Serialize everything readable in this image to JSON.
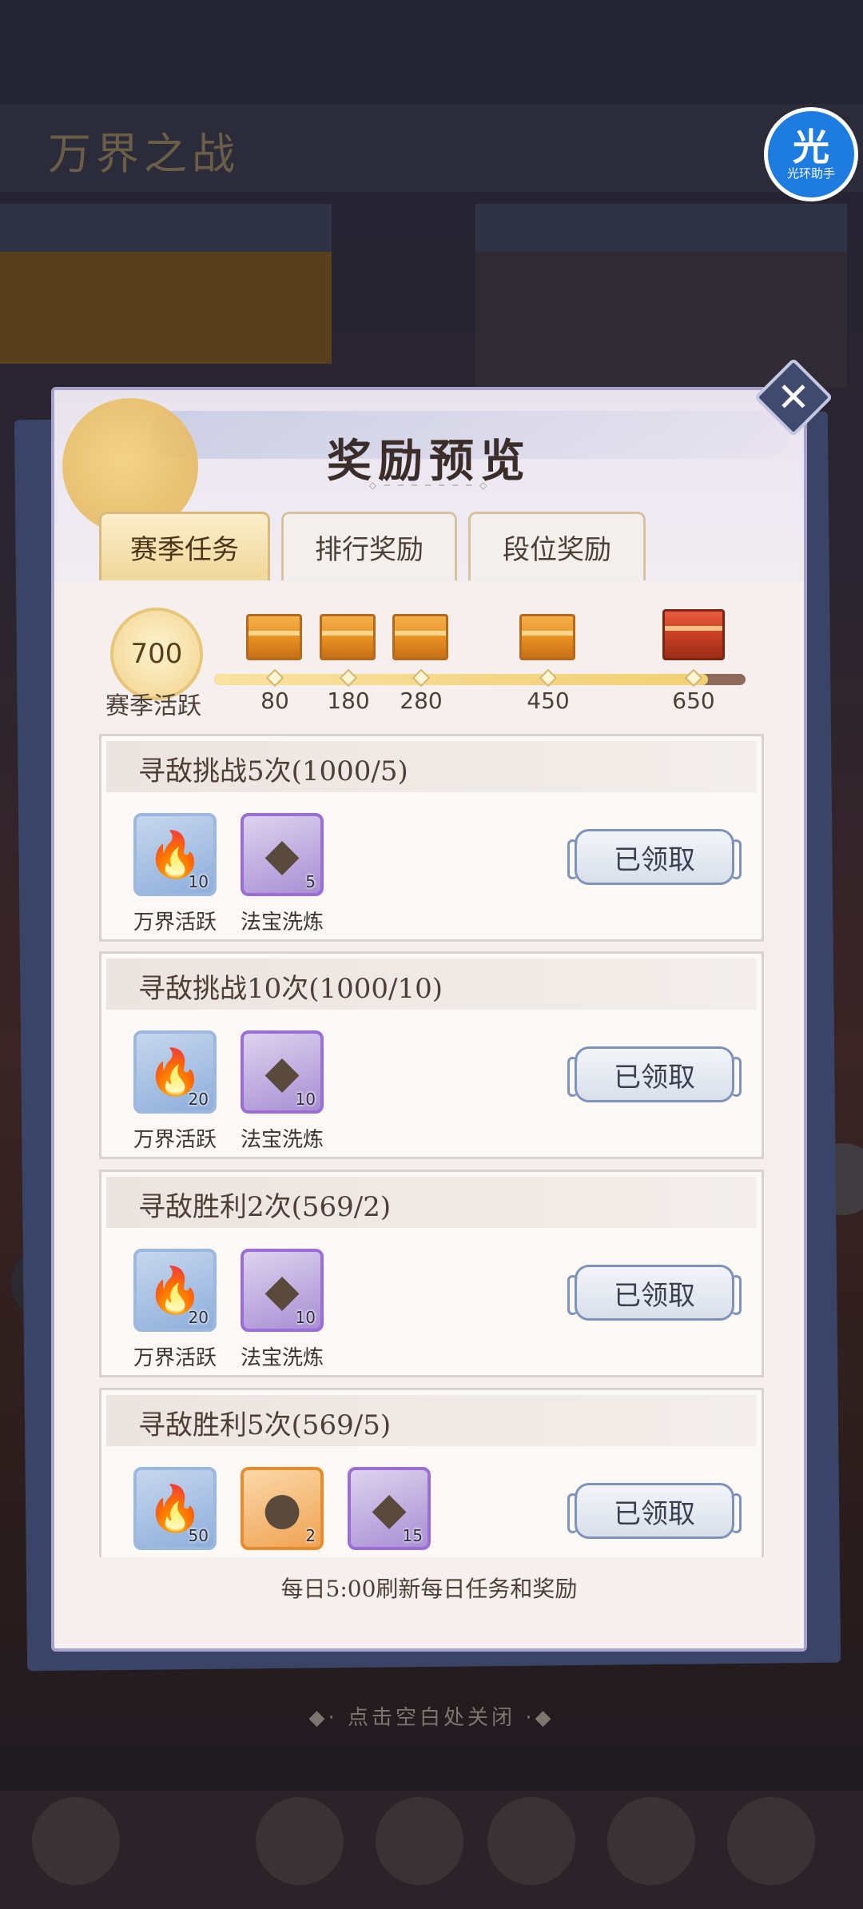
{
  "background": {
    "game_title": "万界之战",
    "close_hint": "◆· 点击空白处关闭 ·◆"
  },
  "assistant": {
    "glyph": "光",
    "label": "光环助手"
  },
  "modal": {
    "title": "奖励预览",
    "close_icon": "close-icon",
    "tabs": [
      {
        "label": "赛季任务",
        "active": true
      },
      {
        "label": "排行奖励",
        "active": false
      },
      {
        "label": "段位奖励",
        "active": false
      }
    ],
    "progress": {
      "current": "700",
      "label": "赛季活跃",
      "milestones": [
        "80",
        "180",
        "280",
        "450",
        "650"
      ],
      "fill_fraction": 0.93
    },
    "tasks": [
      {
        "title": "寻敌挑战5次(1000/5)",
        "rewards": [
          {
            "name": "万界活跃",
            "count": "10",
            "icon": "blue-flame-icon"
          },
          {
            "name": "法宝洗炼",
            "count": "5",
            "icon": "purple-crystal-icon"
          }
        ],
        "button": "已领取"
      },
      {
        "title": "寻敌挑战10次(1000/10)",
        "rewards": [
          {
            "name": "万界活跃",
            "count": "20",
            "icon": "blue-flame-icon"
          },
          {
            "name": "法宝洗炼",
            "count": "10",
            "icon": "purple-crystal-icon"
          }
        ],
        "button": "已领取"
      },
      {
        "title": "寻敌胜利2次(569/2)",
        "rewards": [
          {
            "name": "万界活跃",
            "count": "20",
            "icon": "blue-flame-icon"
          },
          {
            "name": "法宝洗炼",
            "count": "10",
            "icon": "purple-crystal-icon"
          }
        ],
        "button": "已领取"
      },
      {
        "title": "寻敌胜利5次(569/5)",
        "rewards": [
          {
            "name": "",
            "count": "50",
            "icon": "blue-flame-icon"
          },
          {
            "name": "",
            "count": "2",
            "icon": "orange-token-icon"
          },
          {
            "name": "",
            "count": "15",
            "icon": "purple-crystal-icon"
          }
        ],
        "button": "已领取"
      }
    ],
    "footer_note": "每日5:00刷新每日任务和奖励"
  },
  "colors": {
    "modal_bg": "#f3eeef",
    "tab_active": "#f0d79a",
    "claimed_button_border": "#7f93ba",
    "chest_orange": "#e58f22",
    "chest_red": "#c53e24"
  }
}
